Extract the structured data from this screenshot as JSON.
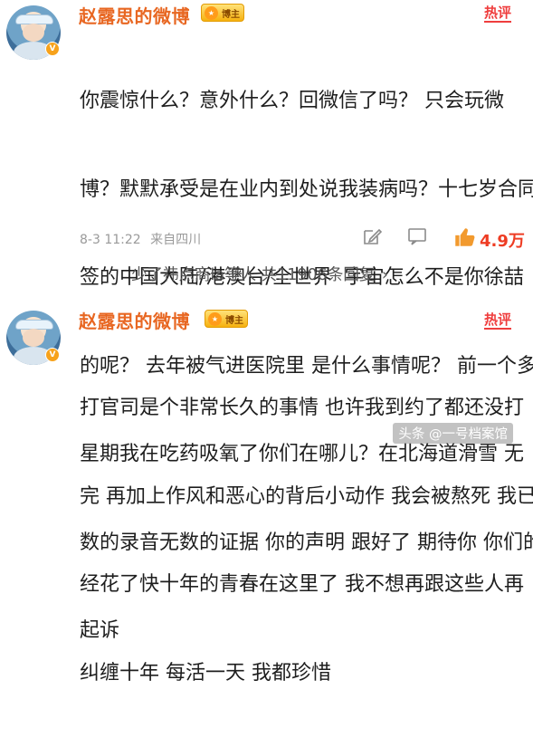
{
  "comments": [
    {
      "author": "赵露思的微博",
      "level_badge": "博主",
      "hot_label": "热评",
      "text_lines": [
        "你震惊什么？意外什么？回微信了吗？ 只会玩微",
        "博？默默承受是在业内到处说我装病吗？十七岁合同",
        "签的中国大陆/港澳台/全世界  宇宙怎么不是你徐喆",
        "的呢？ 去年被气进医院里 是什么事情呢？ 前一个多",
        "星期我在吃药吸氧了你们在哪儿？在北海道滑雪 无",
        "数的录音无数的证据 你的声明 跟好了 期待你 你们的",
        "起诉"
      ],
      "date": "8-3 11:22",
      "location": "来自四川",
      "likes": "4.9万",
      "replies_text": "少了祎点商la等人 共11906条回复",
      "replies_arrow": "›"
    },
    {
      "author": "赵露思的微博",
      "level_badge": "博主",
      "hot_label": "热评",
      "text_lines": [
        "打官司是个非常长久的事情 也许我到约了都还没打",
        "完 再加上作风和恶心的背后小动作 我会被熬死 我已",
        "经花了快十年的青春在这里了 我不想再跟这些人再",
        "纠缠十年 每活一天 我都珍惜"
      ]
    }
  ],
  "watermark": "头条 @一号档案馆",
  "colors": {
    "author": "#e86722",
    "hot": "#ef3d3d",
    "likes": "#ee3c23",
    "meta": "#9a9a9a"
  },
  "icons": [
    "verified-badge-icon",
    "edit-icon",
    "comment-icon",
    "thumbs-up-icon",
    "toutiao-logo-icon"
  ]
}
